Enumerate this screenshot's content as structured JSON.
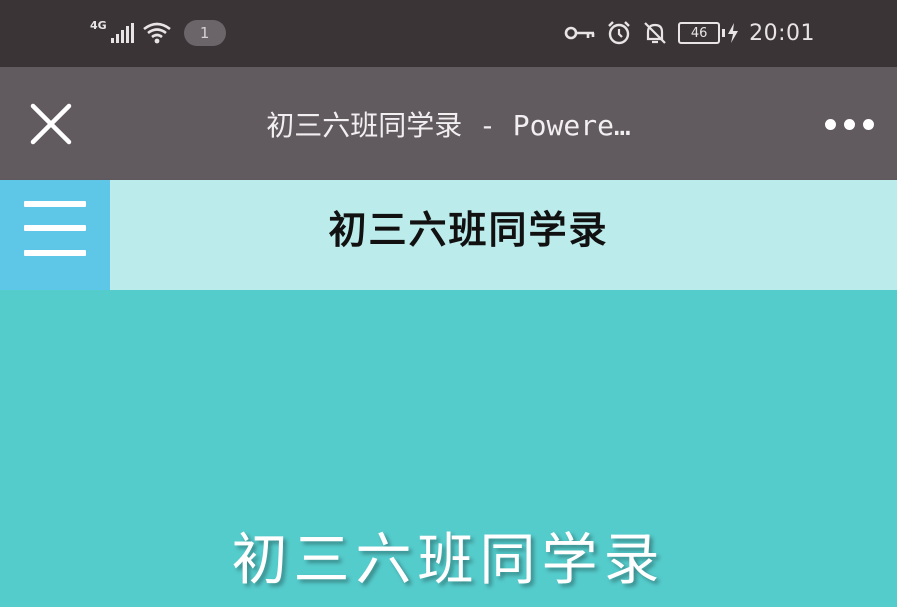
{
  "status_bar": {
    "network_type": "4G",
    "notification_count": "1",
    "battery_level": "46",
    "time": "20:01",
    "icons": [
      "key-icon",
      "alarm-icon",
      "bell-off-icon",
      "charging-icon"
    ]
  },
  "browser": {
    "page_title": "初三六班同学录 - Powere…",
    "close_icon": "close-icon",
    "more_icon": "more-icon"
  },
  "site_header": {
    "title": "初三六班同学录",
    "menu_icon": "menu-icon",
    "colors": {
      "header_bg": "#bcebeb",
      "menu_bg": "#5ec6e6"
    }
  },
  "hero": {
    "title": "初三六班同学录",
    "bg_color": "#55cccc"
  }
}
